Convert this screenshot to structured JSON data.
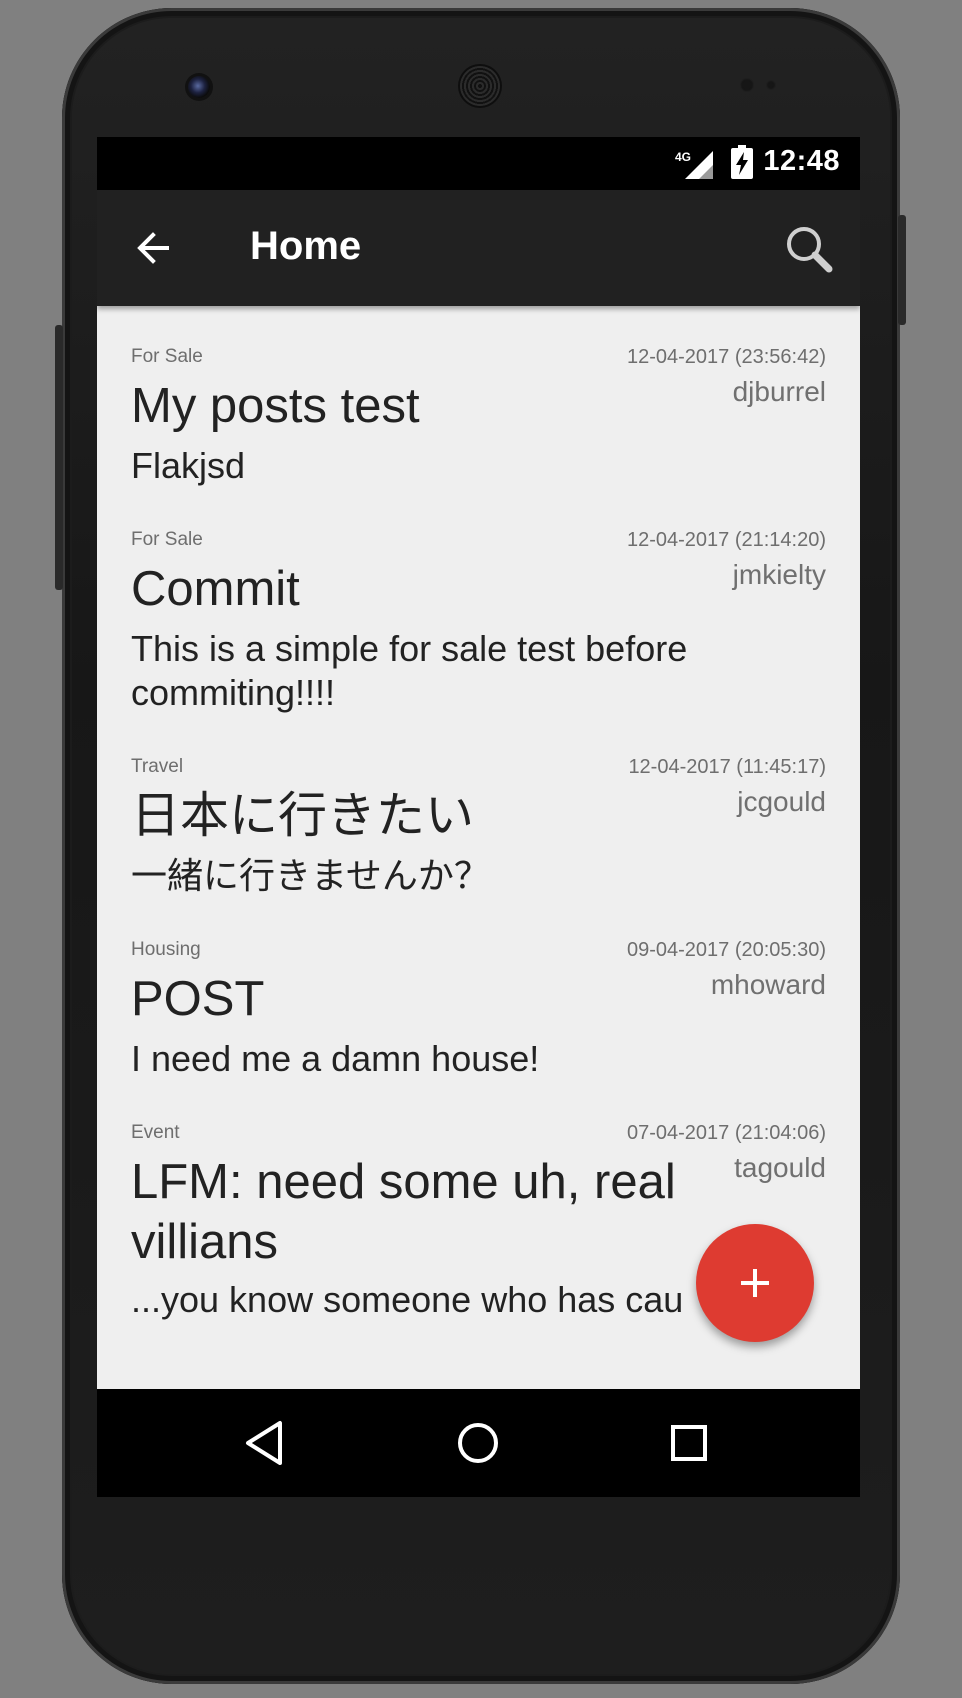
{
  "status_bar": {
    "time": "12:48",
    "network": "4G",
    "network_icon": "signal-icon",
    "battery_icon": "battery-charging-icon"
  },
  "app_bar": {
    "title": "Home",
    "back_icon": "arrow-back-icon",
    "search_icon": "search-icon"
  },
  "posts": [
    {
      "category": "For Sale",
      "date": "12-04-2017 (23:56:42)",
      "user": "djburrel",
      "title": "My posts test",
      "body": "Flakjsd"
    },
    {
      "category": "For Sale",
      "date": "12-04-2017 (21:14:20)",
      "user": "jmkielty",
      "title": "Commit",
      "body": "This is a simple for sale test before commiting!!!!"
    },
    {
      "category": "Travel",
      "date": "12-04-2017 (11:45:17)",
      "user": "jcgould",
      "title": "日本に行きたい",
      "body": "一緒に行きませんか？"
    },
    {
      "category": "Housing",
      "date": "09-04-2017 (20:05:30)",
      "user": "mhoward",
      "title": "POST",
      "body": "I need me a damn house!"
    },
    {
      "category": "Event",
      "date": "07-04-2017 (21:04:06)",
      "user": "tagould",
      "title": "LFM: need some uh, real villians",
      "body": "...you know someone who has cau"
    }
  ],
  "fab": {
    "icon": "plus-icon",
    "color": "#de3b31"
  },
  "nav_bar": {
    "back_icon": "nav-back-icon",
    "home_icon": "nav-home-icon",
    "recents_icon": "nav-recents-icon"
  },
  "colors": {
    "app_bar": "#212121",
    "background": "#efefef",
    "accent": "#de3b31"
  }
}
